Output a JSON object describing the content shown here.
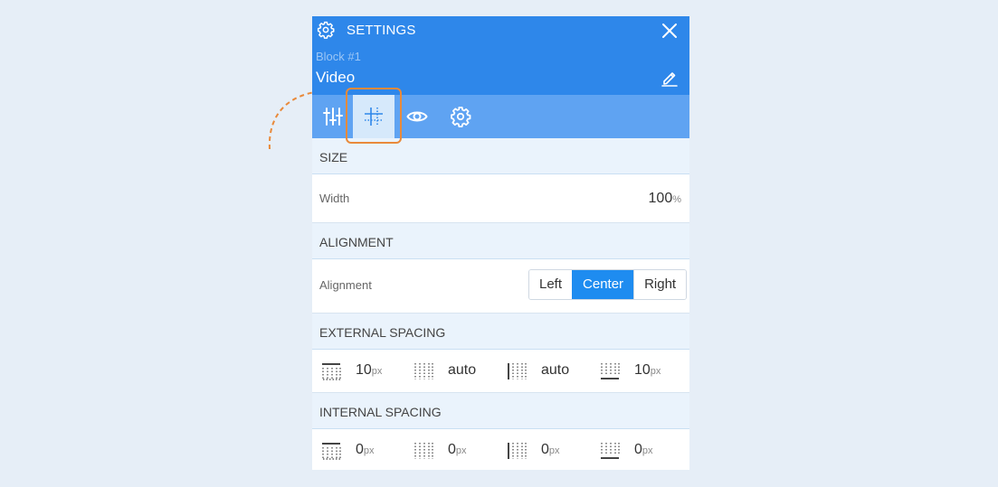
{
  "header": {
    "title": "SETTINGS",
    "block_label": "Block #1",
    "block_name": "Video"
  },
  "tabs": [
    {
      "icon": "sliders-icon"
    },
    {
      "icon": "layout-grid-icon",
      "active": true
    },
    {
      "icon": "eye-icon"
    },
    {
      "icon": "gear-icon"
    }
  ],
  "size": {
    "section_title": "SIZE",
    "width_label": "Width",
    "width_value": "100",
    "width_unit": "%"
  },
  "alignment": {
    "section_title": "ALIGNMENT",
    "label": "Alignment",
    "options": [
      "Left",
      "Center",
      "Right"
    ],
    "selected": "Center"
  },
  "external_spacing": {
    "section_title": "EXTERNAL SPACING",
    "top": {
      "value": "10",
      "unit": "px"
    },
    "left": {
      "value": "auto",
      "unit": ""
    },
    "right": {
      "value": "auto",
      "unit": ""
    },
    "bottom": {
      "value": "10",
      "unit": "px"
    }
  },
  "internal_spacing": {
    "section_title": "INTERNAL SPACING",
    "top": {
      "value": "0",
      "unit": "px"
    },
    "left": {
      "value": "0",
      "unit": "px"
    },
    "right": {
      "value": "0",
      "unit": "px"
    },
    "bottom": {
      "value": "0",
      "unit": "px"
    }
  },
  "colors": {
    "header_bg": "#2e87ea",
    "tabbar_bg": "#5fa3f2",
    "highlight": "#e98a3b",
    "accent": "#1e8cf0"
  }
}
